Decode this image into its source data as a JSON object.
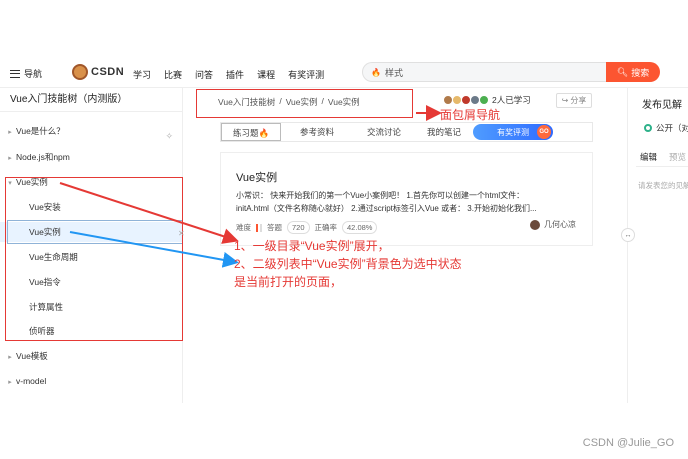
{
  "nav": {
    "menu_label": "导航",
    "logo_text": "CSDN",
    "links": [
      "学习",
      "比赛",
      "问答",
      "插件",
      "课程",
      "有奖评测"
    ],
    "search_value": "样式",
    "search_button": "搜索"
  },
  "sidebar": {
    "title": "Vue入门技能树（内测版）",
    "items": [
      {
        "label": "Vue是什么？",
        "level": 1,
        "arrow": "▸"
      },
      {
        "label": "Node.js和npm",
        "level": 1,
        "arrow": "▸"
      },
      {
        "label": "Vue实例",
        "level": 1,
        "arrow": "▾"
      },
      {
        "label": "Vue安装",
        "level": 2
      },
      {
        "label": "Vue实例",
        "level": 2,
        "selected": true
      },
      {
        "label": "Vue生命周期",
        "level": 2
      },
      {
        "label": "Vue指令",
        "level": 2
      },
      {
        "label": "计算属性",
        "level": 2
      },
      {
        "label": "侦听器",
        "level": 2
      },
      {
        "label": "Vue模板",
        "level": 1,
        "arrow": "▸"
      },
      {
        "label": "v-model",
        "level": 1,
        "arrow": "▸"
      }
    ]
  },
  "breadcrumb": {
    "items": [
      "Vue入门技能树",
      "Vue实例",
      "Vue实例"
    ],
    "separator": "/"
  },
  "header": {
    "learners": "2人已学习",
    "share": "分享"
  },
  "tabs": {
    "items": [
      "练习题",
      "参考资料",
      "交流讨论",
      "我的笔记"
    ],
    "promo": "有奖评测",
    "promo_badge": "GO"
  },
  "card": {
    "title": "Vue实例",
    "desc_line1": "小常识： 快来开始我们的第一个Vue小案例吧！ 1.首先你可以创建一个html文件：",
    "desc_line2": "initA.html（文件名称随心就好） 2.通过script标签引入Vue 或者： 3.开始初始化我们...",
    "difficulty_label": "难度",
    "answers_label": "答题",
    "answers_value": "720",
    "accuracy_label": "正确率",
    "accuracy_value": "42.08%",
    "author": "几何心凉"
  },
  "right_panel": {
    "title": "发布见解",
    "visibility": "公开（对",
    "tab_edit": "编辑",
    "tab_preview": "预览",
    "hint": "请发表您的见解"
  },
  "annotations": {
    "crumb_note": "面包屑导航",
    "note_line1": "1、一级目录“Vue实例”展开，",
    "note_line2": "2、二级列表中“Vue实例”背景色为选中状态",
    "note_line3": "是当前打开的页面，"
  },
  "watermark": "CSDN @Julie_GO",
  "colors": {
    "brand": "#fc5531",
    "annotation_red": "#e53935",
    "selected_bg": "#e8f3ff",
    "arrow_blue": "#2196f3"
  }
}
